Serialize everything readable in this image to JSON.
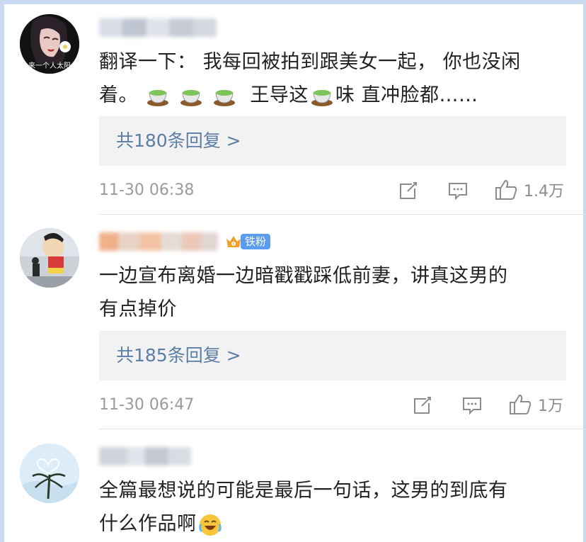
{
  "comments": [
    {
      "text_line1": "翻译一下：  我每回被拍到跟美女一起，  你也没闲",
      "text_line2_a": "着。",
      "text_line2_b": "王导这",
      "text_line2_c": "味 直冲脸都……",
      "avatar_text": "来一个人太阳",
      "replies": "共180条回复 >",
      "time": "11-30 06:38",
      "likes": "1.4万"
    },
    {
      "text_line1": "一边宣布离婚一边暗戳戳踩低前妻，讲真这男的",
      "text_line2": "有点掉价",
      "badge": "铁粉",
      "replies": "共185条回复 >",
      "time": "11-30 06:47",
      "likes": "1万"
    },
    {
      "text_line1": "全篇最想说的可能是最后一句话，这男的到底有",
      "text_line2": "什么作品啊"
    }
  ],
  "icons": {
    "share": "share-icon",
    "comment": "comment-icon",
    "like": "thumbs-up-icon",
    "tea": "tea-emoji-icon",
    "laugh": "laughing-crying-emoji-icon"
  },
  "colors": {
    "reply_link": "#5b7ea6",
    "reply_bg": "#f2f2f2",
    "badge": "#5b9cf0",
    "meta": "#9a9a9a"
  }
}
